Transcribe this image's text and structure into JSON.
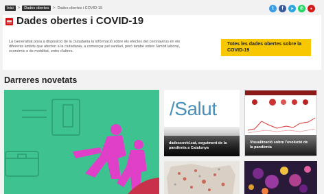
{
  "breadcrumb": {
    "home": "Inici",
    "section": "Dades obertes",
    "current": "Dades obertes i COVID-19",
    "separator": ">"
  },
  "social": [
    {
      "name": "twitter-icon",
      "glyph": "t",
      "color": "#3a9ce5"
    },
    {
      "name": "facebook-icon",
      "glyph": "f",
      "color": "#3b5998"
    },
    {
      "name": "telegram-icon",
      "glyph": "➤",
      "color": "#2ca5e0"
    },
    {
      "name": "whatsapp-icon",
      "glyph": "✆",
      "color": "#25d366"
    },
    {
      "name": "share-icon",
      "glyph": "●",
      "color": "#d21a1a"
    }
  ],
  "header": {
    "title": "Dades obertes i COVID-19",
    "intro": "La Generalitat posa a disposició de la ciutadania la informació sobre els efectes del coronavirus en els diferents àmbits que afecten a la ciutadania, a començar pel sanitari, però també sobre l'àmbit laboral, econòmic o de mobilitat, entre d'altres.",
    "cta": "Totes les dades obertes sobre la COVID-19"
  },
  "news": {
    "title": "Darreres novetats",
    "cards": [
      {
        "caption": "dadescovid.cat, seguiment de la pandèmia a Catalunya",
        "logo": "/Salut"
      },
      {
        "caption": "Visualització sobre l'evolució de la pandèmia"
      }
    ]
  },
  "colors": {
    "accent": "#d21a1a",
    "cta": "#f7c800",
    "feature": "#3ec28f",
    "figure": "#e040c8"
  }
}
